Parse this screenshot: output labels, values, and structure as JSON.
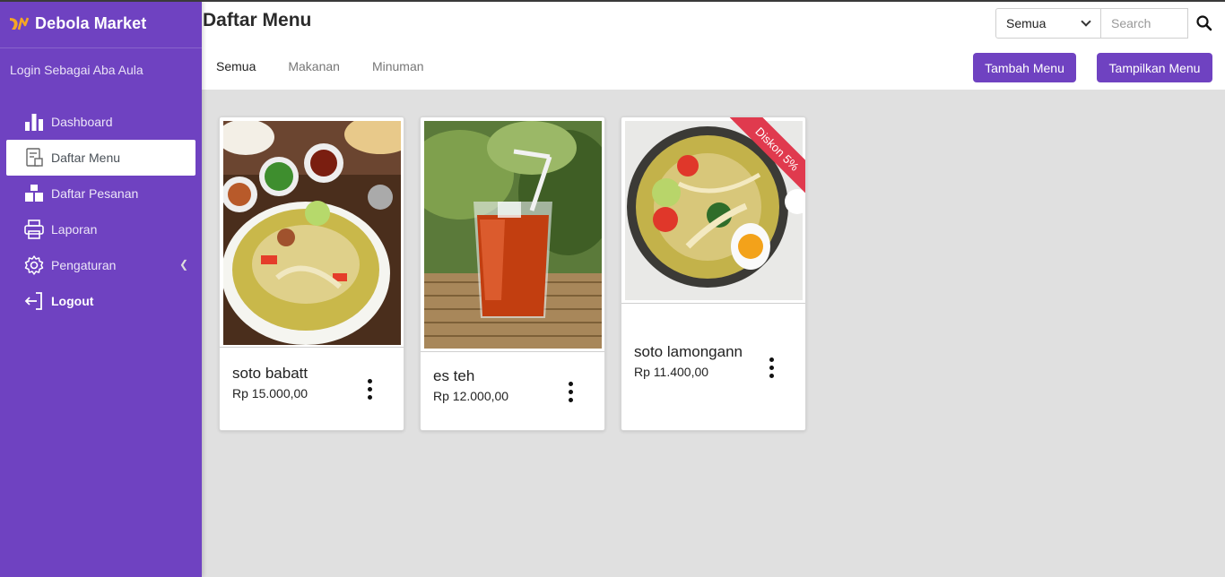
{
  "app": {
    "name": "Debola Market"
  },
  "sidebar": {
    "login_as": "Login Sebagai Aba Aula",
    "items": [
      {
        "label": "Dashboard",
        "icon": "bar-chart-icon"
      },
      {
        "label": "Daftar Menu",
        "icon": "menu-list-icon",
        "active": true
      },
      {
        "label": "Daftar Pesanan",
        "icon": "boxes-icon"
      },
      {
        "label": "Laporan",
        "icon": "printer-icon"
      },
      {
        "label": "Pengaturan",
        "icon": "gear-icon"
      },
      {
        "label": "Logout",
        "icon": "logout-icon"
      }
    ]
  },
  "header": {
    "title": "Daftar Menu",
    "filter": {
      "selected": "Semua"
    },
    "search": {
      "placeholder": "Search"
    },
    "tabs": [
      {
        "label": "Semua",
        "active": true
      },
      {
        "label": "Makanan"
      },
      {
        "label": "Minuman"
      }
    ],
    "add_button": "Tambah Menu",
    "show_button": "Tampilkan Menu"
  },
  "menu_items": [
    {
      "name": "soto babatt",
      "price": "Rp 15.000,00"
    },
    {
      "name": "es teh",
      "price": "Rp 12.000,00"
    },
    {
      "name": "soto lamongann",
      "price": "Rp 11.400,00",
      "badge": "Diskon 5%"
    }
  ],
  "colors": {
    "primary": "#6f42c1",
    "ribbon": "#e03a4e",
    "background": "#e0e0e0"
  }
}
